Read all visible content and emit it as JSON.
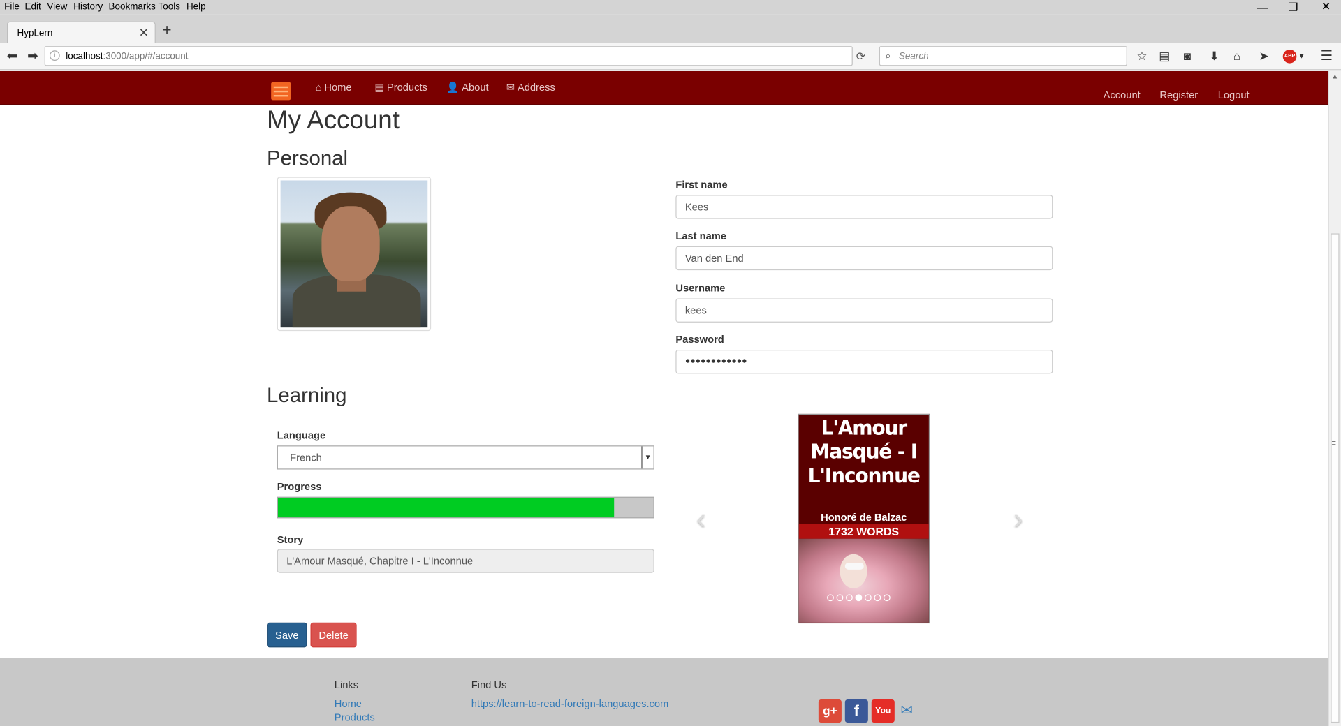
{
  "browser": {
    "menu": [
      "File",
      "Edit",
      "View",
      "History",
      "Bookmarks",
      "Tools",
      "Help"
    ],
    "tab_title": "HypLern",
    "url_host": "localhost",
    "url_rest": ":3000/app/#/account",
    "search_placeholder": "Search",
    "abp_label": "ABP"
  },
  "site_nav": {
    "items": [
      {
        "label": "Home",
        "icon": "home-icon"
      },
      {
        "label": "Products",
        "icon": "list-icon"
      },
      {
        "label": "About",
        "icon": "user-icon"
      },
      {
        "label": "Address",
        "icon": "envelope-icon"
      }
    ],
    "right": [
      "Account",
      "Register",
      "Logout"
    ]
  },
  "page": {
    "title": "My Account",
    "personal_heading": "Personal",
    "learning_heading": "Learning"
  },
  "personal": {
    "first_name_label": "First name",
    "first_name": "Kees",
    "last_name_label": "Last name",
    "last_name": "Van den End",
    "username_label": "Username",
    "username": "kees",
    "password_label": "Password",
    "password": "●●●●●●●●●●●●"
  },
  "learning": {
    "language_label": "Language",
    "language": "French",
    "progress_label": "Progress",
    "progress_fraction": 0.895,
    "story_label": "Story",
    "story": "L'Amour Masqué, Chapitre I - L'Inconnue"
  },
  "actions": {
    "save": "Save",
    "delete": "Delete"
  },
  "carousel": {
    "book_title_lines": [
      "L'Amour",
      "Masqué - I",
      "L'Inconnue"
    ],
    "author": "Honoré de Balzac",
    "words": "1732 WORDS",
    "dot_count": 7,
    "active_dot": 3
  },
  "footer": {
    "links_heading": "Links",
    "links": [
      "Home",
      "Products"
    ],
    "find_heading": "Find Us",
    "find_url": "https://learn-to-read-foreign-languages.com"
  },
  "colors": {
    "nav_bg": "#7a0000",
    "progress_fill": "#00cc22",
    "save_btn": "#286090",
    "delete_btn": "#d9534f"
  }
}
